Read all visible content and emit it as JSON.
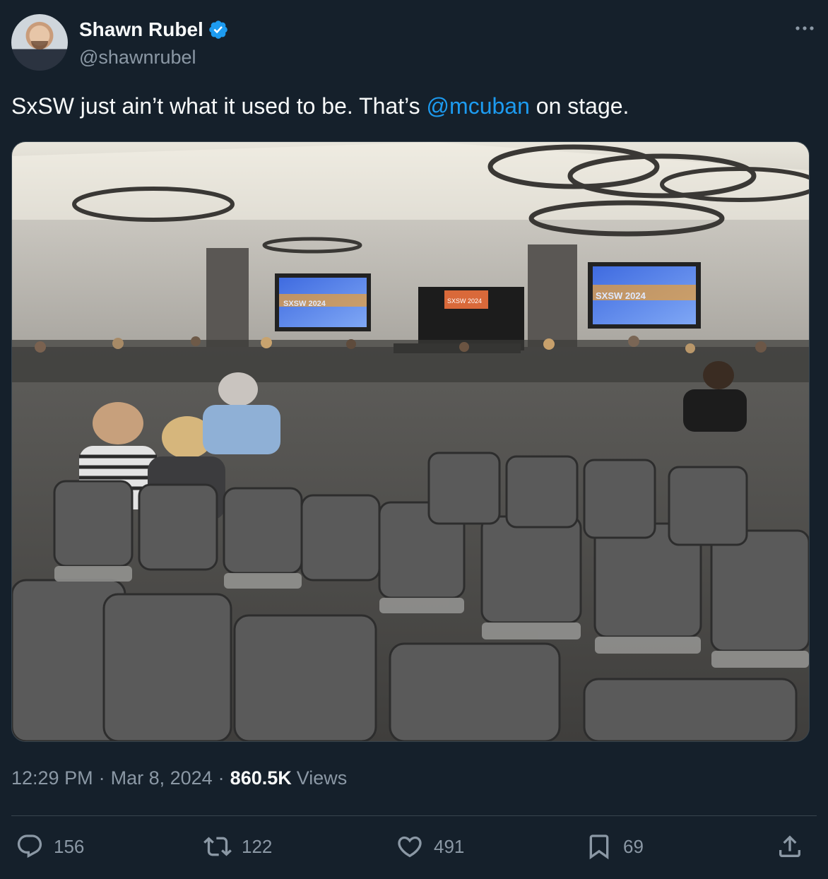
{
  "author": {
    "display_name": "Shawn Rubel",
    "handle": "@shawnrubel",
    "verified": true
  },
  "tweet": {
    "text_before": "SxSW just ain’t what it used to be. That’s ",
    "mention": "@mcuban",
    "text_after": " on stage."
  },
  "media": {
    "screens": [
      "SXSW",
      "2024"
    ],
    "stage_banner": "SXSW 2024"
  },
  "meta": {
    "time": "12:29 PM",
    "separator": "·",
    "date": "Mar 8, 2024",
    "views_count": "860.5K",
    "views_label": "Views"
  },
  "actions": {
    "replies": "156",
    "reposts": "122",
    "likes": "491",
    "bookmarks": "69"
  },
  "colors": {
    "background": "#15202b",
    "text": "#f7f9f9",
    "secondary": "#8b98a5",
    "accent": "#1d9bf0",
    "border": "#38444d"
  }
}
